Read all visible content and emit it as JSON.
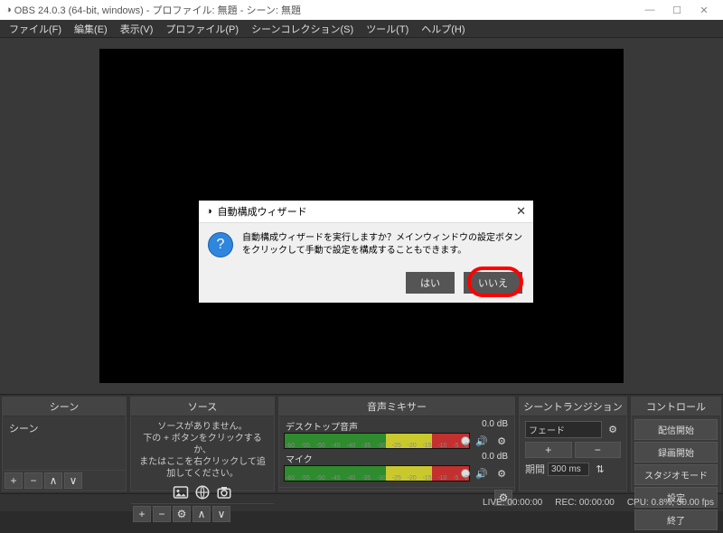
{
  "window": {
    "title": "OBS 24.0.3 (64-bit, windows) - プロファイル: 無題 - シーン: 無題",
    "minimize": "—",
    "maximize": "☐",
    "close": "✕"
  },
  "menubar": {
    "file": "ファイル(F)",
    "edit": "編集(E)",
    "view": "表示(V)",
    "profile": "プロファイル(P)",
    "scene_collection": "シーンコレクション(S)",
    "tools": "ツール(T)",
    "help": "ヘルプ(H)"
  },
  "panels": {
    "scenes": {
      "title": "シーン",
      "items": [
        "シーン"
      ]
    },
    "sources": {
      "title": "ソース",
      "empty1": "ソースがありません。",
      "empty2": "下の + ボタンをクリックするか、",
      "empty3": "またはここを右クリックして追加してください。"
    },
    "mixer": {
      "title": "音声ミキサー",
      "tracks": [
        {
          "name": "デスクトップ音声",
          "level": "0.0 dB",
          "fill": 100,
          "slider": 98
        },
        {
          "name": "マイク",
          "level": "0.0 dB",
          "fill": 100,
          "slider": 98
        }
      ],
      "ticks": [
        "-60",
        "-55",
        "-50",
        "-45",
        "-40",
        "-35",
        "-30",
        "-25",
        "-20",
        "-15",
        "-10",
        "-5",
        "0"
      ]
    },
    "transitions": {
      "title": "シーントランジション",
      "selected": "フェード",
      "duration_label": "期間",
      "duration_value": "300 ms"
    },
    "controls": {
      "title": "コントロール",
      "start_stream": "配信開始",
      "start_record": "録画開始",
      "studio_mode": "スタジオモード",
      "settings": "設定",
      "exit": "終了"
    }
  },
  "statusbar": {
    "live": "LIVE: 00:00:00",
    "rec": "REC: 00:00:00",
    "cpu": "CPU: 0.8%, 30.00 fps"
  },
  "dialog": {
    "title": "自動構成ウィザード",
    "text": "自動構成ウィザードを実行しますか？メインウィンドウの設定ボタンをクリックして手動で設定を構成することもできます。",
    "yes": "はい",
    "no": "いいえ"
  },
  "icons": {
    "plus": "+",
    "minus": "−",
    "gear": "⚙",
    "up": "∧",
    "down": "∨",
    "pipe": "|",
    "speaker": "🔊",
    "updn": "⇅"
  }
}
